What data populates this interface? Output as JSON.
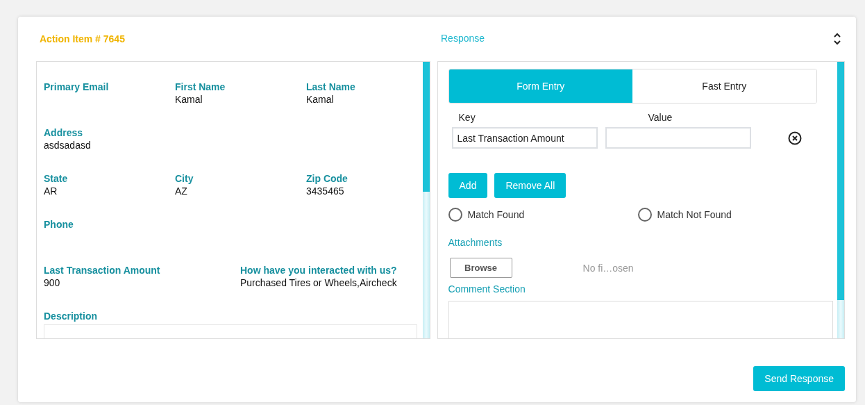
{
  "header": {
    "title": "Action Item # 7645",
    "response_title": "Response"
  },
  "details": {
    "rows": [
      {
        "fields": [
          {
            "label": "Primary Email"
          },
          {
            "label": "First Name",
            "value": "Kamal"
          },
          {
            "label": "Last Name",
            "value": "Kamal"
          }
        ]
      },
      {
        "fields": [
          {
            "label": "Address",
            "value": "asdsadasd"
          }
        ]
      },
      {
        "fields": [
          {
            "label": "State",
            "value": "AR"
          },
          {
            "label": "City",
            "value": "AZ"
          },
          {
            "label": "Zip Code",
            "value": "3435465"
          }
        ]
      },
      {
        "fields": [
          {
            "label": "Phone"
          }
        ]
      },
      {
        "fields": [
          {
            "label": "Last Transaction Amount",
            "value": "900"
          },
          {
            "label": "How have you interacted with us?",
            "value": "Purchased Tires or Wheels,Aircheck"
          }
        ]
      }
    ],
    "description": {
      "label": "Description"
    }
  },
  "response": {
    "tabs": [
      {
        "label": "Form Entry",
        "selected": true
      },
      {
        "label": "Fast Entry",
        "selected": false
      }
    ],
    "key_label": "Key",
    "value_label": "Value",
    "entries": [
      {
        "key": "Last Transaction Amount"
      }
    ],
    "buttons": [
      "Add",
      "Remove All"
    ],
    "radios": [
      {
        "label": "Match Found",
        "selected": false
      },
      {
        "label": "Match Not Found",
        "selected": false
      }
    ],
    "attachments": {
      "label": "Attachments",
      "button": "Browse",
      "file_name": "No fi…osen"
    },
    "comment": {
      "label": "Comment Section"
    }
  },
  "send_button": "Send Response"
}
